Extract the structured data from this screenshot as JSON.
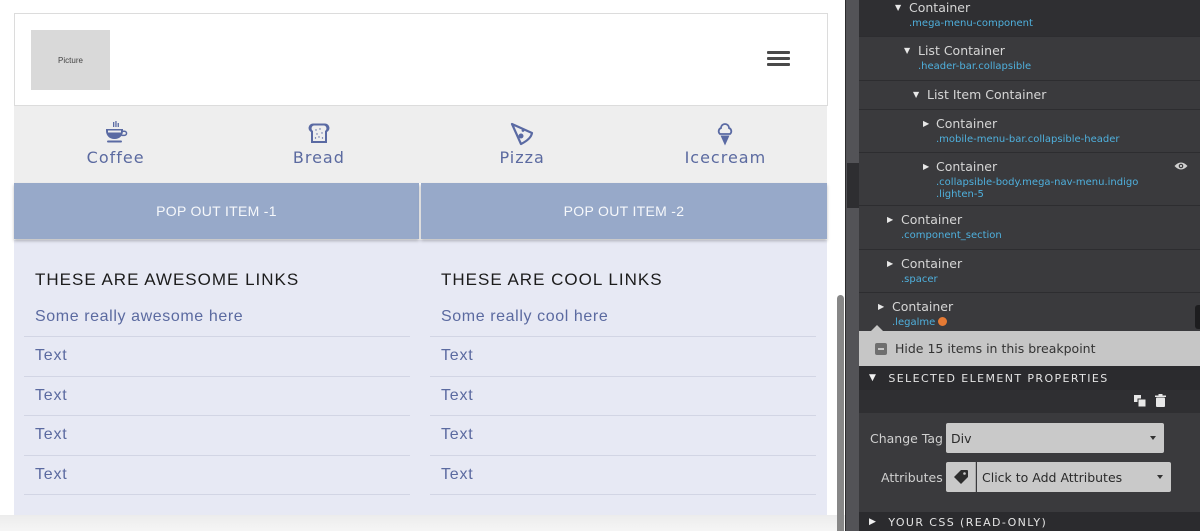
{
  "canvas": {
    "header": {
      "picture_label": "Picture",
      "menu_icon": "hamburger-icon"
    },
    "categories": [
      {
        "label": "Coffee",
        "icon": "coffee-cup-icon"
      },
      {
        "label": "Bread",
        "icon": "bread-toast-icon"
      },
      {
        "label": "Pizza",
        "icon": "pizza-slice-icon"
      },
      {
        "label": "Icecream",
        "icon": "ice-cream-icon"
      }
    ],
    "popouts": [
      {
        "label": "POP OUT ITEM -1"
      },
      {
        "label": "POP OUT ITEM -2"
      }
    ],
    "columns": [
      {
        "title": "THESE ARE AWESOME LINKS",
        "links": [
          "Some really awesome here",
          "Text",
          "Text",
          "Text",
          "Text"
        ]
      },
      {
        "title": "THESE ARE COOL LINKS",
        "links": [
          "Some really cool here",
          "Text",
          "Text",
          "Text",
          "Text"
        ]
      }
    ]
  },
  "inspector": {
    "tree": [
      {
        "name": "Container",
        "class": ".mega-menu-component",
        "expanded": true
      },
      {
        "name": "List Container",
        "class": ".header-bar.collapsible",
        "expanded": true
      },
      {
        "name": "List Item Container",
        "class": "",
        "expanded": true
      },
      {
        "name": "Container",
        "class": ".mobile-menu-bar.collapsible-header",
        "expanded": false
      },
      {
        "name": "Container",
        "class_line1": ".collapsible-body.mega-nav-menu.indigo",
        "class_line2": ".lighten-5",
        "expanded": false,
        "visible_icon": "eye-icon"
      },
      {
        "name": "Container",
        "class": ".component_section",
        "expanded": false
      },
      {
        "name": "Container",
        "class": ".spacer",
        "expanded": false
      },
      {
        "name": "Container",
        "class": ".legalme",
        "expanded": false,
        "status_dot_color": "#e57a34"
      }
    ],
    "hide_items_label": "Hide 15 items in this breakpoint",
    "selected_properties_title": "SELECTED ELEMENT PROPERTIES",
    "change_tag_label": "Change Tag",
    "change_tag_value": "Div",
    "attributes_label": "Attributes",
    "attributes_placeholder": "Click to Add Attributes",
    "your_css_title": "YOUR CSS (READ-ONLY)"
  },
  "colors": {
    "accent_indigo": "#5b6aa0",
    "popout_bg": "#97a9c9",
    "mega_body_bg": "#e7e9f4",
    "class_text": "#4fb0dd"
  }
}
